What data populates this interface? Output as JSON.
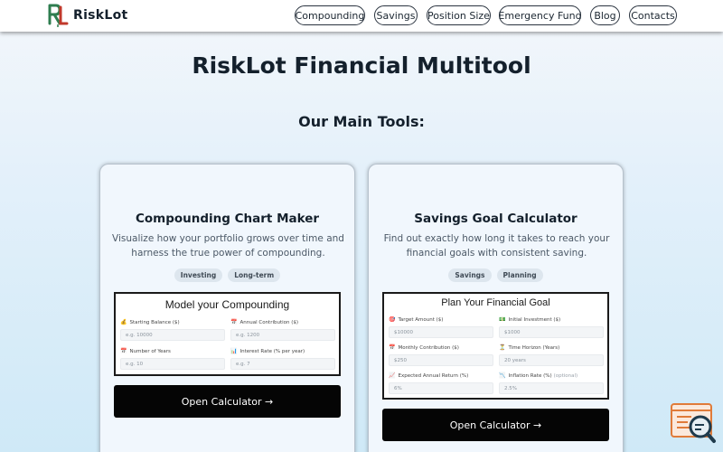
{
  "brand": {
    "name": "RiskLot"
  },
  "nav": [
    {
      "label": "Compounding"
    },
    {
      "label": "Savings"
    },
    {
      "label": "Position Size"
    },
    {
      "label": "Emergency Fund"
    },
    {
      "label": "Blog"
    },
    {
      "label": "Contacts"
    }
  ],
  "page_title": "RiskLot Financial Multitool",
  "section_title": "Our Main Tools:",
  "colors": {
    "accent": "#050505",
    "logo_red": "#c0392b",
    "logo_green": "#2e7d4f",
    "float_icon": "#e07b39"
  },
  "cards": [
    {
      "title": "Compounding Chart Maker",
      "description": "Visualize how your portfolio grows over time and harness the true power of compounding.",
      "tags": [
        "Investing",
        "Long-term"
      ],
      "preview": {
        "title": "Model your Compounding",
        "fields": [
          {
            "icon": "💰",
            "label": "Starting Balance ($)",
            "value": "e.g. 10000"
          },
          {
            "icon": "📅",
            "label": "Annual Contribution ($)",
            "value": "e.g. 1200"
          },
          {
            "icon": "📅",
            "label": "Number of Years",
            "value": "e.g. 10"
          },
          {
            "icon": "📊",
            "label": "Interest Rate (% per year)",
            "value": "e.g. 7"
          }
        ]
      },
      "button": "Open Calculator →"
    },
    {
      "title": "Savings Goal Calculator",
      "description": "Find out exactly how long it takes to reach your financial goals with consistent saving.",
      "tags": [
        "Savings",
        "Planning"
      ],
      "preview": {
        "title": "Plan Your Financial Goal",
        "fields": [
          {
            "icon": "🎯",
            "label": "Target Amount ($)",
            "value": "$10000"
          },
          {
            "icon": "💵",
            "label": "Initial Investment ($)",
            "value": "$1000"
          },
          {
            "icon": "📅",
            "label": "Monthly Contribution ($)",
            "value": "$250"
          },
          {
            "icon": "⏳",
            "label": "Time Horizon (Years)",
            "value": "20 years"
          },
          {
            "icon": "📈",
            "label": "Expected Annual Return (%)",
            "value": "6%"
          },
          {
            "icon": "📉",
            "label": "Inflation Rate (%)",
            "optional": "(optional)",
            "value": "2.5%"
          }
        ]
      },
      "button": "Open Calculator →"
    }
  ]
}
